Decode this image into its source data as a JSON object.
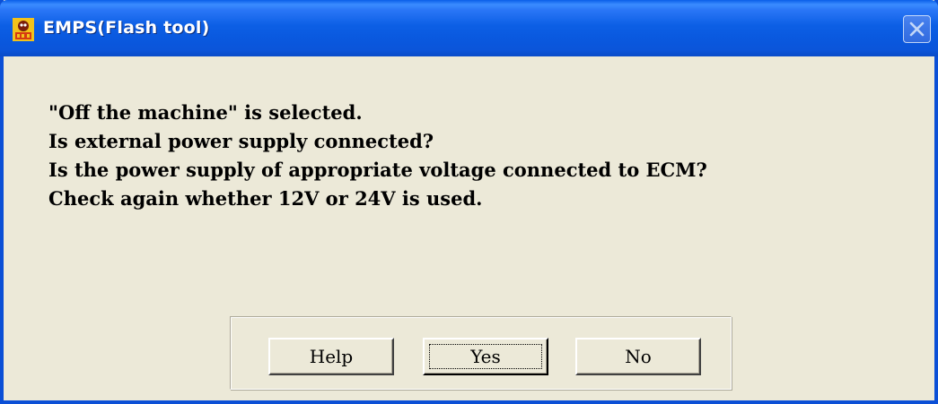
{
  "window": {
    "title": "EMPS(Flash tool)",
    "title_color": "#ffffff",
    "titlebar_color": "#0a5ee8",
    "background_color": "#ece9d8"
  },
  "icons": {
    "app": "app-icon",
    "close": "close-icon"
  },
  "messages": [
    "\"Off the machine\" is selected.",
    "Is external power supply connected?",
    "Is the power supply of appropriate voltage connected to ECM?",
    "Check again whether 12V or 24V is used."
  ],
  "buttons": {
    "help_label": "Help",
    "yes_label": "Yes",
    "no_label": "No",
    "focused": "Yes"
  }
}
